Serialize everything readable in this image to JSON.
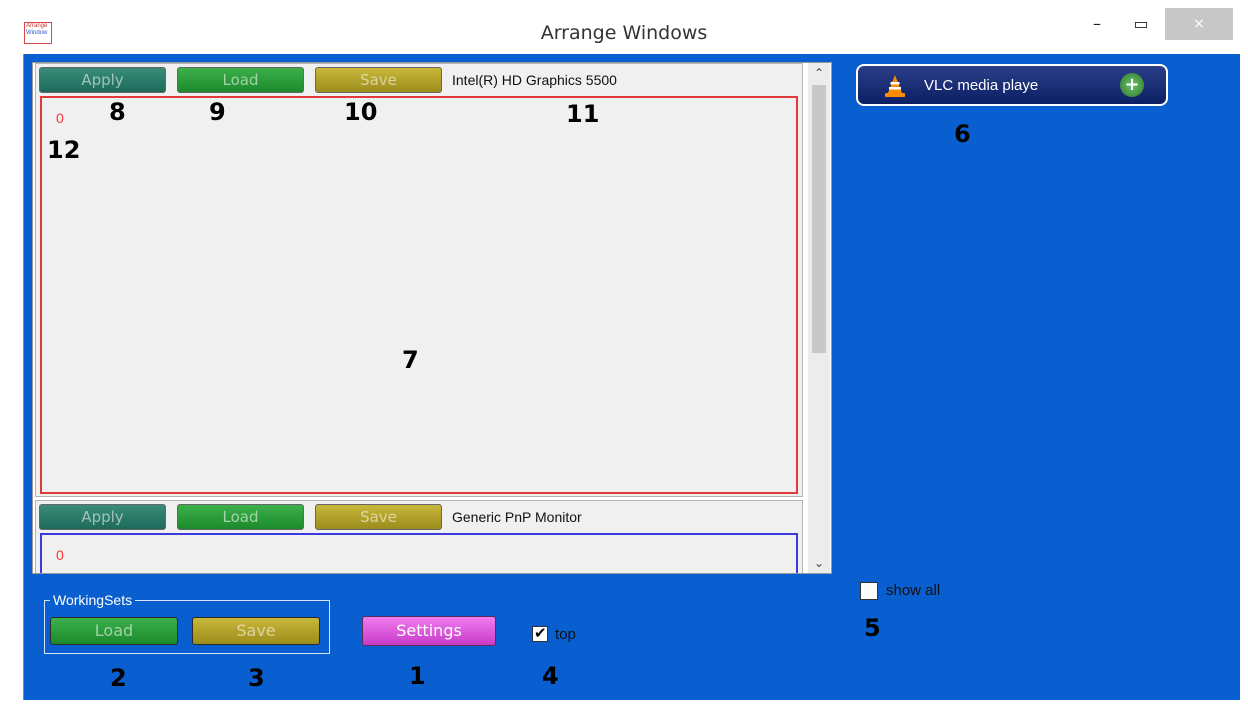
{
  "window": {
    "title": "Arrange Windows",
    "icon_text_line1": "Arrange",
    "icon_text_line2": "Window",
    "minimize_glyph": "–",
    "maximize_glyph": "▭",
    "close_glyph": "×"
  },
  "monitors": [
    {
      "apply_label": "Apply",
      "load_label": "Load",
      "save_label": "Save",
      "name": "Intel(R) HD Graphics 5500",
      "index": "0",
      "border_color": "#e03a3a"
    },
    {
      "apply_label": "Apply",
      "load_label": "Load",
      "save_label": "Save",
      "name": "Generic PnP Monitor",
      "index": "0",
      "border_color": "#3a3ae0"
    }
  ],
  "scrollbar": {
    "up_glyph": "⌃",
    "down_glyph": "⌄"
  },
  "apps": [
    {
      "label": "VLC media playe",
      "icon": "vlc-cone-icon",
      "add_glyph": "+"
    }
  ],
  "working_sets": {
    "legend": "WorkingSets",
    "load_label": "Load",
    "save_label": "Save"
  },
  "settings_label": "Settings",
  "top_checkbox": {
    "label": "top",
    "checked": true,
    "tick": "✔"
  },
  "show_all_checkbox": {
    "label": "show all",
    "checked": false
  },
  "callouts": {
    "n1": "1",
    "n2": "2",
    "n3": "3",
    "n4": "4",
    "n5": "5",
    "n6": "6",
    "n7": "7",
    "n8": "8",
    "n9": "9",
    "n10": "10",
    "n11": "11",
    "n12": "12"
  },
  "colors": {
    "client_bg": "#0a5fd0",
    "apply": "#1d6a5a",
    "load": "#1c8a2c",
    "save": "#9c8c1c",
    "settings": "#c83ac8"
  }
}
